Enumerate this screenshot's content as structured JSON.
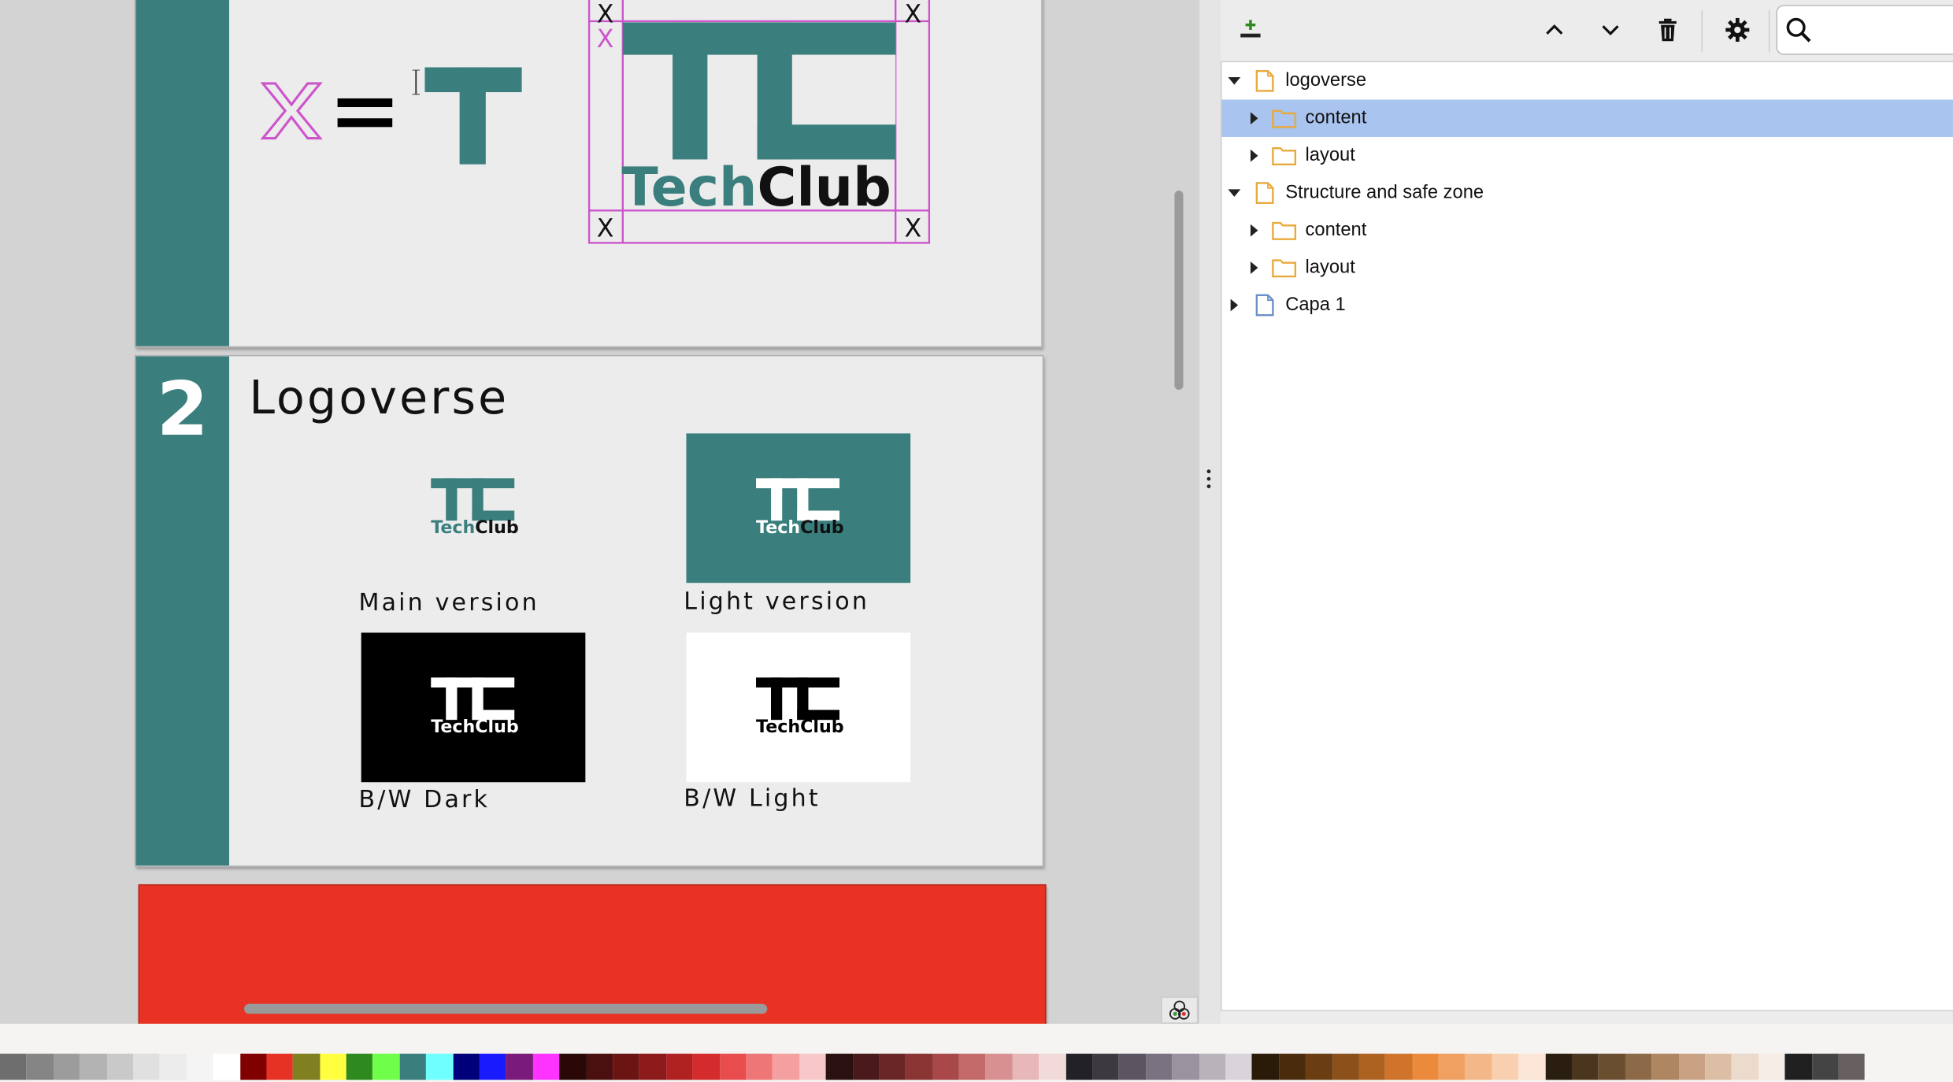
{
  "canvas": {
    "slide1": {
      "equation_x": "X",
      "equation_eq": "=",
      "equation_t": "T",
      "safe_marker": "X",
      "logo_word_tech": "Tech",
      "logo_word_club": "Club"
    },
    "slide2": {
      "number": "2",
      "title": "Logoverse",
      "variants": [
        {
          "caption": "Main version",
          "bg": "#ececec",
          "mark": "#3a7f7e",
          "tech": "#3a7f7e",
          "club": "#111111"
        },
        {
          "caption": "Light version",
          "bg": "#3a7f7e",
          "mark": "#ffffff",
          "tech": "#ffffff",
          "club": "#111111"
        },
        {
          "caption": "B/W Dark",
          "bg": "#000000",
          "mark": "#ffffff",
          "tech": "#ffffff",
          "club": "#ffffff"
        },
        {
          "caption": "B/W Light",
          "bg": "#ffffff",
          "mark": "#000000",
          "tech": "#000000",
          "club": "#000000"
        }
      ],
      "logo_word_tech": "Tech",
      "logo_word_club": "Club"
    }
  },
  "layers_panel": {
    "toolbar": {
      "add_icon": "add-layer-icon",
      "raise_icon": "chevron-up-icon",
      "lower_icon": "chevron-down-icon",
      "delete_icon": "trash-icon",
      "settings_icon": "gear-icon",
      "search_icon": "search-icon"
    },
    "tree": [
      {
        "label": "logoverse",
        "type": "page",
        "expanded": true,
        "depth": 0
      },
      {
        "label": "content",
        "type": "folder",
        "expanded": false,
        "depth": 1,
        "selected": true
      },
      {
        "label": "layout",
        "type": "folder",
        "expanded": false,
        "depth": 1
      },
      {
        "label": "Structure and safe zone",
        "type": "page",
        "expanded": true,
        "depth": 0
      },
      {
        "label": "content",
        "type": "folder",
        "expanded": false,
        "depth": 1
      },
      {
        "label": "layout",
        "type": "folder",
        "expanded": false,
        "depth": 1
      },
      {
        "label": "Capa 1",
        "type": "layer",
        "expanded": false,
        "depth": 0
      }
    ]
  },
  "colors": {
    "teal": "#3a7f7e",
    "magenta": "#cc55cc",
    "selection": "#a8c4ef",
    "red_page": "#e83324",
    "folder": "#e9a93b",
    "layer_icon": "#6b8fc7"
  },
  "palette": [
    "#6e6e6e",
    "#858585",
    "#9c9c9c",
    "#b3b3b3",
    "#c9c9c9",
    "#e0e0e0",
    "#ececec",
    "#f4f4f4",
    "#ffffff",
    "#800000",
    "#e63224",
    "#808020",
    "#ffff40",
    "#2e8a1e",
    "#6fff4a",
    "#3a7f7e",
    "#70ffff",
    "#00007a",
    "#1a1aff",
    "#7a1a7a",
    "#ff33ff",
    "#2a0808",
    "#4a0f0f",
    "#6a1414",
    "#8c1a1a",
    "#b02222",
    "#d42c2c",
    "#e84c4c",
    "#ee7676",
    "#f4a0a0",
    "#f8c8c8",
    "#2a1010",
    "#4a1a1a",
    "#6a2626",
    "#8a3434",
    "#a84848",
    "#c46a6a",
    "#d89090",
    "#e8b8b8",
    "#f2dada",
    "#222226",
    "#3c3a40",
    "#5a5560",
    "#7a7280",
    "#9a929e",
    "#b8b2ba",
    "#d8d4da",
    "#2a1a08",
    "#4a2c0c",
    "#6a3e12",
    "#8c501a",
    "#ae6222",
    "#d0742c",
    "#ec8a3c",
    "#f0a060",
    "#f4b888",
    "#f8d0b0",
    "#fbe6d8",
    "#2a1e10",
    "#4a361e",
    "#6a4e30",
    "#8c6a48",
    "#ae8662",
    "#c8a282",
    "#dcbea4",
    "#ecdacc",
    "#f6eee6",
    "#202020",
    "#444444",
    "#686060"
  ]
}
